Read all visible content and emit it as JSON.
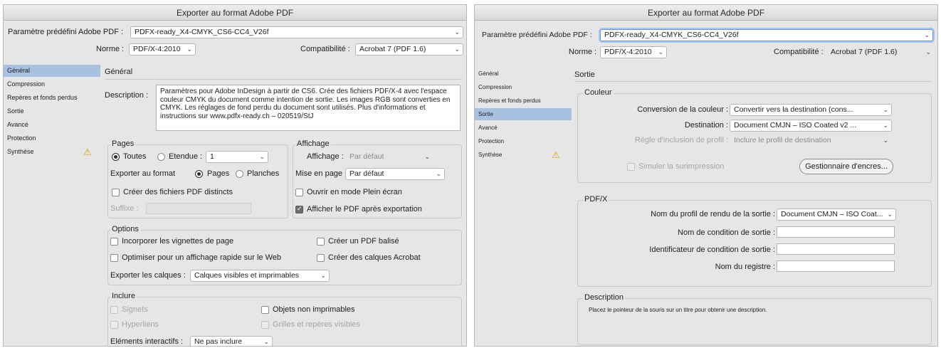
{
  "title": "Exporter au format Adobe PDF",
  "preset_label": "Paramètre prédéfini Adobe PDF :",
  "preset_value": "PDFX-ready_X4-CMYK_CS6-CC4_V26f",
  "norme_label": "Norme :",
  "norme_value": "PDF/X-4:2010",
  "compat_label": "Compatibilité :",
  "compat_value": "Acrobat 7 (PDF 1.6)",
  "sidebar": {
    "items": [
      {
        "label": "Général"
      },
      {
        "label": "Compression"
      },
      {
        "label": "Repères et fonds perdus"
      },
      {
        "label": "Sortie"
      },
      {
        "label": "Avancé"
      },
      {
        "label": "Protection"
      },
      {
        "label": "Synthèse"
      }
    ],
    "warning_icon": "warning-icon",
    "warning_glyph": "⚠"
  },
  "left": {
    "section_title": "Général",
    "description_label": "Description :",
    "description_text": "Paramètres pour Adobe InDesign à partir de CS6. Crée des fichiers PDF/X-4 avec l'espace couleur CMYK du document comme intention de sortie. Les images RGB sont converties en CMYK. Les réglages de fond perdu du document sont utilisés. Plus d'informations et instructions sur www.pdfx-ready.ch – 020519/StJ",
    "pages": {
      "title": "Pages",
      "toutes": "Toutes",
      "etendue": "Etendue :",
      "etendue_value": "1",
      "exporter_format": "Exporter au format",
      "pages_opt": "Pages",
      "planches_opt": "Planches",
      "creer_distincts": "Créer des fichiers PDF distincts",
      "suffixe": "Suffixe :"
    },
    "affichage": {
      "title": "Affichage",
      "affichage_label": "Affichage :",
      "affichage_value": "Par défaut",
      "mise_en_page_label": "Mise en page :",
      "mise_en_page_value": "Par défaut",
      "plein_ecran": "Ouvrir en mode Plein écran",
      "afficher_pdf": "Afficher le PDF après exportation"
    },
    "options": {
      "title": "Options",
      "vignettes": "Incorporer les vignettes de page",
      "optimiser": "Optimiser pour un affichage rapide sur le Web",
      "balise": "Créer un PDF balisé",
      "calques_acrobat": "Créer des calques Acrobat",
      "exporter_calques_label": "Exporter les calques :",
      "exporter_calques_value": "Calques visibles et imprimables"
    },
    "inclure": {
      "title": "Inclure",
      "signets": "Signets",
      "hyperliens": "Hyperliens",
      "objets_non_imprimables": "Objets non imprimables",
      "grilles": "Grilles et repères visibles",
      "elements_label": "Eléments interactifs :",
      "elements_value": "Ne pas inclure"
    }
  },
  "right": {
    "section_title": "Sortie",
    "couleur": {
      "title": "Couleur",
      "conversion_label": "Conversion de la couleur :",
      "conversion_value": "Convertir vers la destination (cons...",
      "destination_label": "Destination :",
      "destination_value": "Document CMJN – ISO Coated v2 ...",
      "regle_label": "Règle d'inclusion de profil :",
      "regle_value": "Inclure le profil de destination",
      "simuler": "Simuler la surimpression",
      "gestionnaire_button": "Gestionnaire d'encres..."
    },
    "pdfx": {
      "title": "PDF/X",
      "profil_label": "Nom du profil de rendu de la sortie :",
      "profil_value": "Document CMJN – ISO Coat...",
      "condition_label": "Nom de condition de sortie :",
      "identificateur_label": "Identificateur de condition de sortie :",
      "registre_label": "Nom du registre :"
    },
    "description": {
      "title": "Description",
      "text": "Placez le pointeur de la souris sur un titre pour obtenir une description."
    }
  }
}
